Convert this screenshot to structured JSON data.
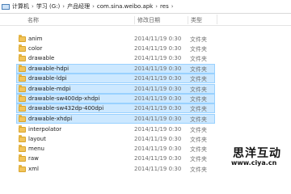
{
  "address_bar": {
    "crumbs": [
      "计算机",
      "学习 (G:)",
      "产品经理",
      "com.sina.weibo.apk",
      "res"
    ],
    "separator": "›",
    "dropdown": "▾"
  },
  "columns": {
    "name": "名称",
    "date": "修改日期",
    "type": "类型"
  },
  "folders": [
    {
      "name": "anim",
      "date": "2014/11/19 0:30",
      "type": "文件夹",
      "selected": false
    },
    {
      "name": "color",
      "date": "2014/11/19 0:30",
      "type": "文件夹",
      "selected": false
    },
    {
      "name": "drawable",
      "date": "2014/11/19 0:30",
      "type": "文件夹",
      "selected": false
    },
    {
      "name": "drawable-hdpi",
      "date": "2014/11/19 0:30",
      "type": "文件夹",
      "selected": true
    },
    {
      "name": "drawable-ldpi",
      "date": "2014/11/19 0:30",
      "type": "文件夹",
      "selected": true
    },
    {
      "name": "drawable-mdpi",
      "date": "2014/11/19 0:30",
      "type": "文件夹",
      "selected": true
    },
    {
      "name": "drawable-sw400dp-xhdpi",
      "date": "2014/11/19 0:30",
      "type": "文件夹",
      "selected": true
    },
    {
      "name": "drawable-sw432dp-400dpi",
      "date": "2014/11/19 0:30",
      "type": "文件夹",
      "selected": true
    },
    {
      "name": "drawable-xhdpi",
      "date": "2014/11/19 0:30",
      "type": "文件夹",
      "selected": true
    },
    {
      "name": "interpolator",
      "date": "2014/11/19 0:30",
      "type": "文件夹",
      "selected": false
    },
    {
      "name": "layout",
      "date": "2014/11/19 0:30",
      "type": "文件夹",
      "selected": false
    },
    {
      "name": "menu",
      "date": "2014/11/19 0:30",
      "type": "文件夹",
      "selected": false
    },
    {
      "name": "raw",
      "date": "2014/11/19 0:30",
      "type": "文件夹",
      "selected": false
    },
    {
      "name": "xml",
      "date": "2014/11/19 0:30",
      "type": "文件夹",
      "selected": false
    }
  ],
  "watermark": {
    "title": "思洋互动",
    "url": "www.ciya.cn"
  },
  "colors": {
    "selection_bg": "#cce8ff",
    "selection_border": "#99d1ff",
    "folder": "#f2c45a"
  }
}
